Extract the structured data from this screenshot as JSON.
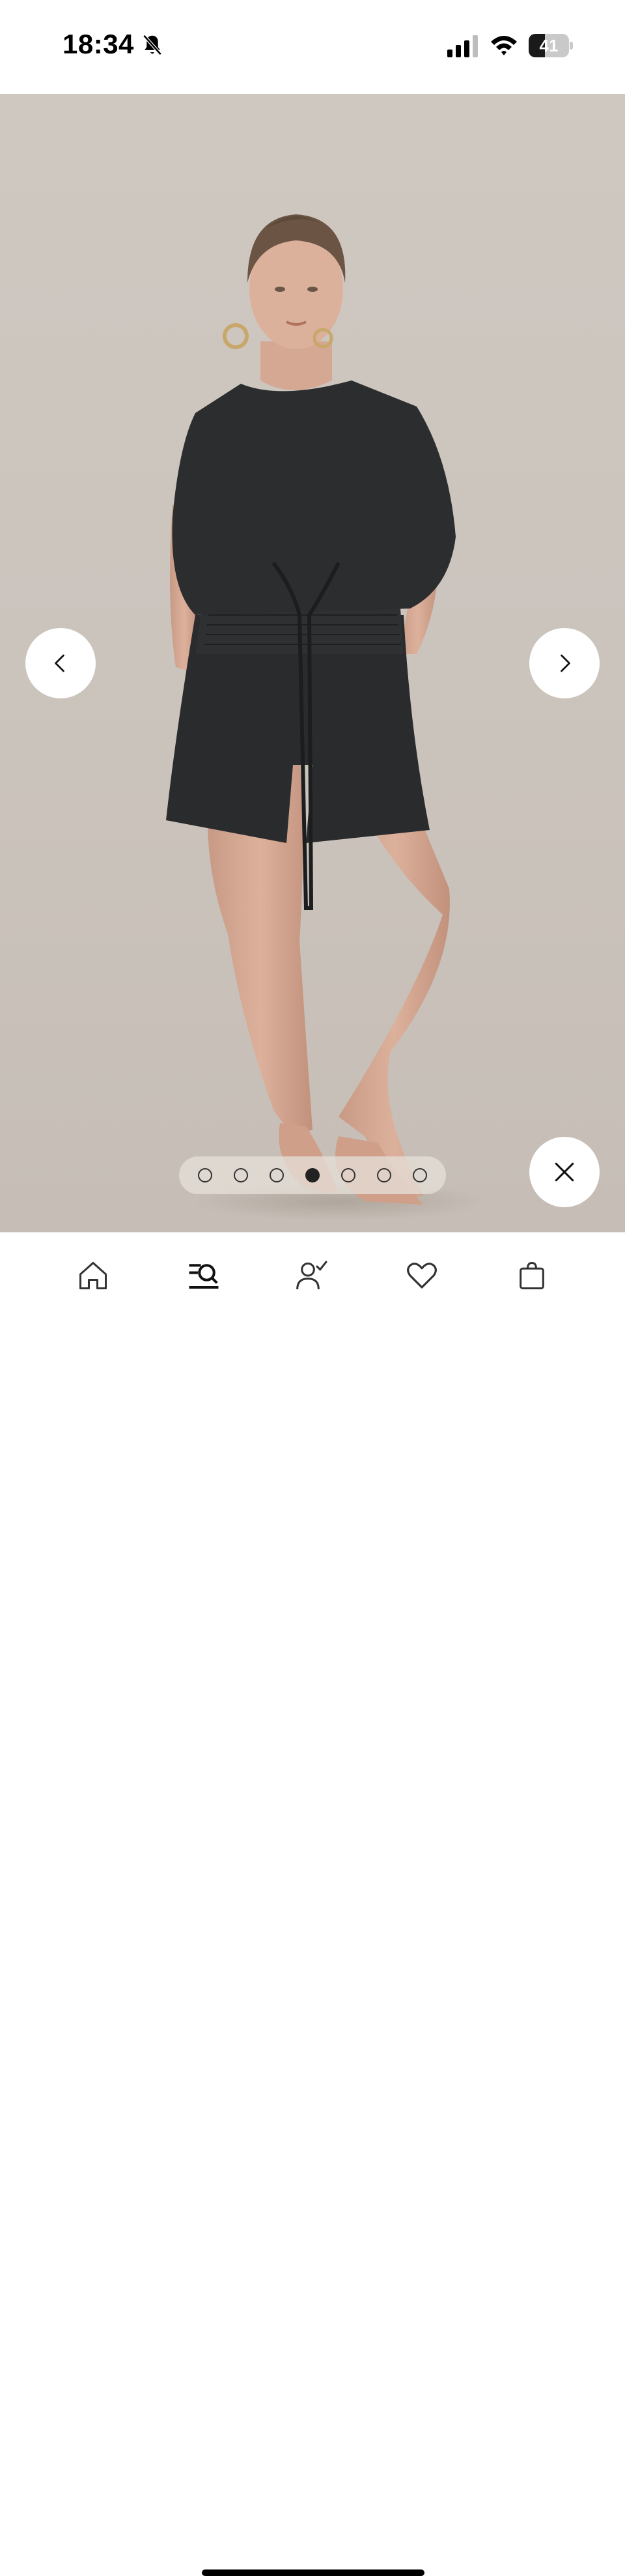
{
  "status_bar": {
    "time": "18:34",
    "battery_level": "41",
    "icons": [
      "bell-slash-icon",
      "signal-icon",
      "wifi-icon",
      "battery-icon"
    ]
  },
  "gallery": {
    "image": "product-photo-black-linen-top-and-shorts",
    "dot_count": 7,
    "active_index": 3,
    "background_color": "#cbc4bd"
  },
  "navigation": {
    "prev_icon": "chevron-left-icon",
    "next_icon": "chevron-right-icon",
    "close_icon": "close-icon"
  },
  "tab_bar": {
    "tabs": [
      {
        "icon": "home-icon"
      },
      {
        "icon": "search-menu-icon"
      },
      {
        "icon": "account-icon"
      },
      {
        "icon": "heart-icon"
      },
      {
        "icon": "shopping-bag-icon"
      }
    ]
  }
}
